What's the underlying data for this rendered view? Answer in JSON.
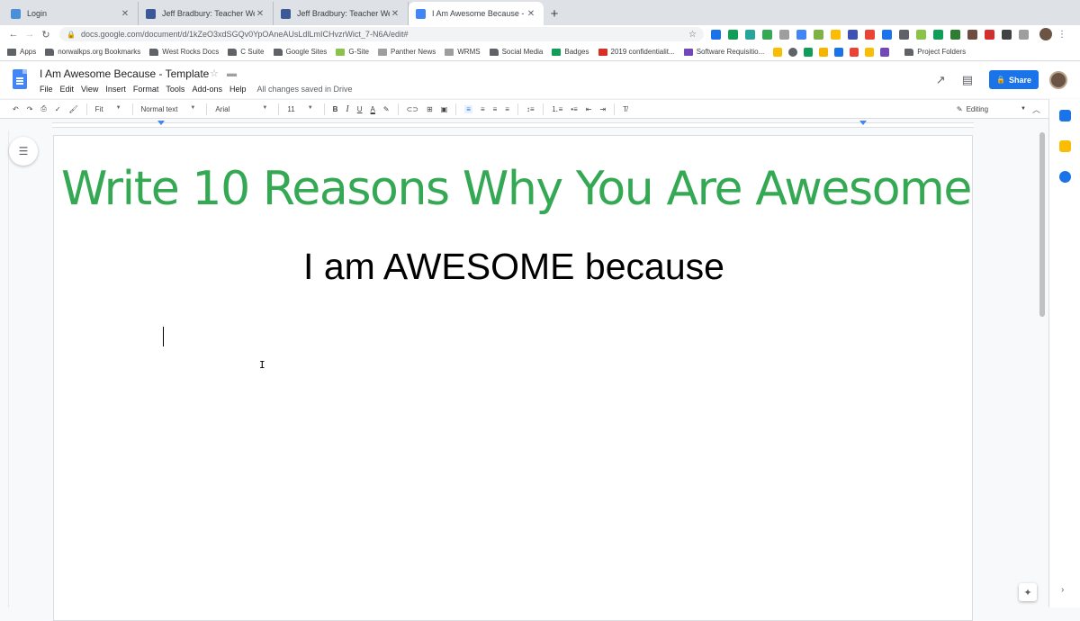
{
  "browser": {
    "tabs": [
      {
        "title": "Login",
        "color": "#4a90d9",
        "active": false
      },
      {
        "title": "Jeff Bradbury: Teacher Website",
        "color": "#3b5998",
        "active": false
      },
      {
        "title": "Jeff Bradbury: Teacher Website",
        "color": "#3b5998",
        "active": false
      },
      {
        "title": "I Am Awesome Because - Templ",
        "color": "#4285f4",
        "active": true
      }
    ],
    "new_tab": "+",
    "url": "docs.google.com/document/d/1kZeO3xdSGQv0YpOAneAUsLdlLmICHvzrWict_7-N6A/edit#",
    "bookmarks": [
      {
        "label": "Apps",
        "kind": "grid"
      },
      {
        "label": "norwalkps.org Bookmarks",
        "kind": "folder"
      },
      {
        "label": "West Rocks Docs",
        "kind": "folder"
      },
      {
        "label": "C Suite",
        "kind": "folder"
      },
      {
        "label": "Google Sites",
        "kind": "folder"
      },
      {
        "label": "G-Site",
        "kind": "icon"
      },
      {
        "label": "Panther News",
        "kind": "icon"
      },
      {
        "label": "WRMS",
        "kind": "icon"
      },
      {
        "label": "Social Media",
        "kind": "folder"
      },
      {
        "label": "Badges",
        "kind": "icon"
      },
      {
        "label": "2019 confidentialit...",
        "kind": "icon"
      },
      {
        "label": "Software Requisitio...",
        "kind": "icon"
      }
    ],
    "bookmark_last": "Project Folders"
  },
  "docs": {
    "title": "I Am Awesome Because - Template",
    "menu": [
      "File",
      "Edit",
      "View",
      "Insert",
      "Format",
      "Tools",
      "Add-ons",
      "Help"
    ],
    "save_status": "All changes saved in Drive",
    "share_label": "Share",
    "toolbar": {
      "zoom": "Fit",
      "style": "Normal text",
      "font": "Arial",
      "size": "11",
      "bold": "B",
      "italic": "I",
      "underline": "U",
      "text_color": "A",
      "mode": "Editing"
    },
    "content": {
      "heading": "Write 10 Reasons Why You Are Awesome",
      "subheading": "I am AWESOME because",
      "heading_color": "#34a853"
    }
  }
}
